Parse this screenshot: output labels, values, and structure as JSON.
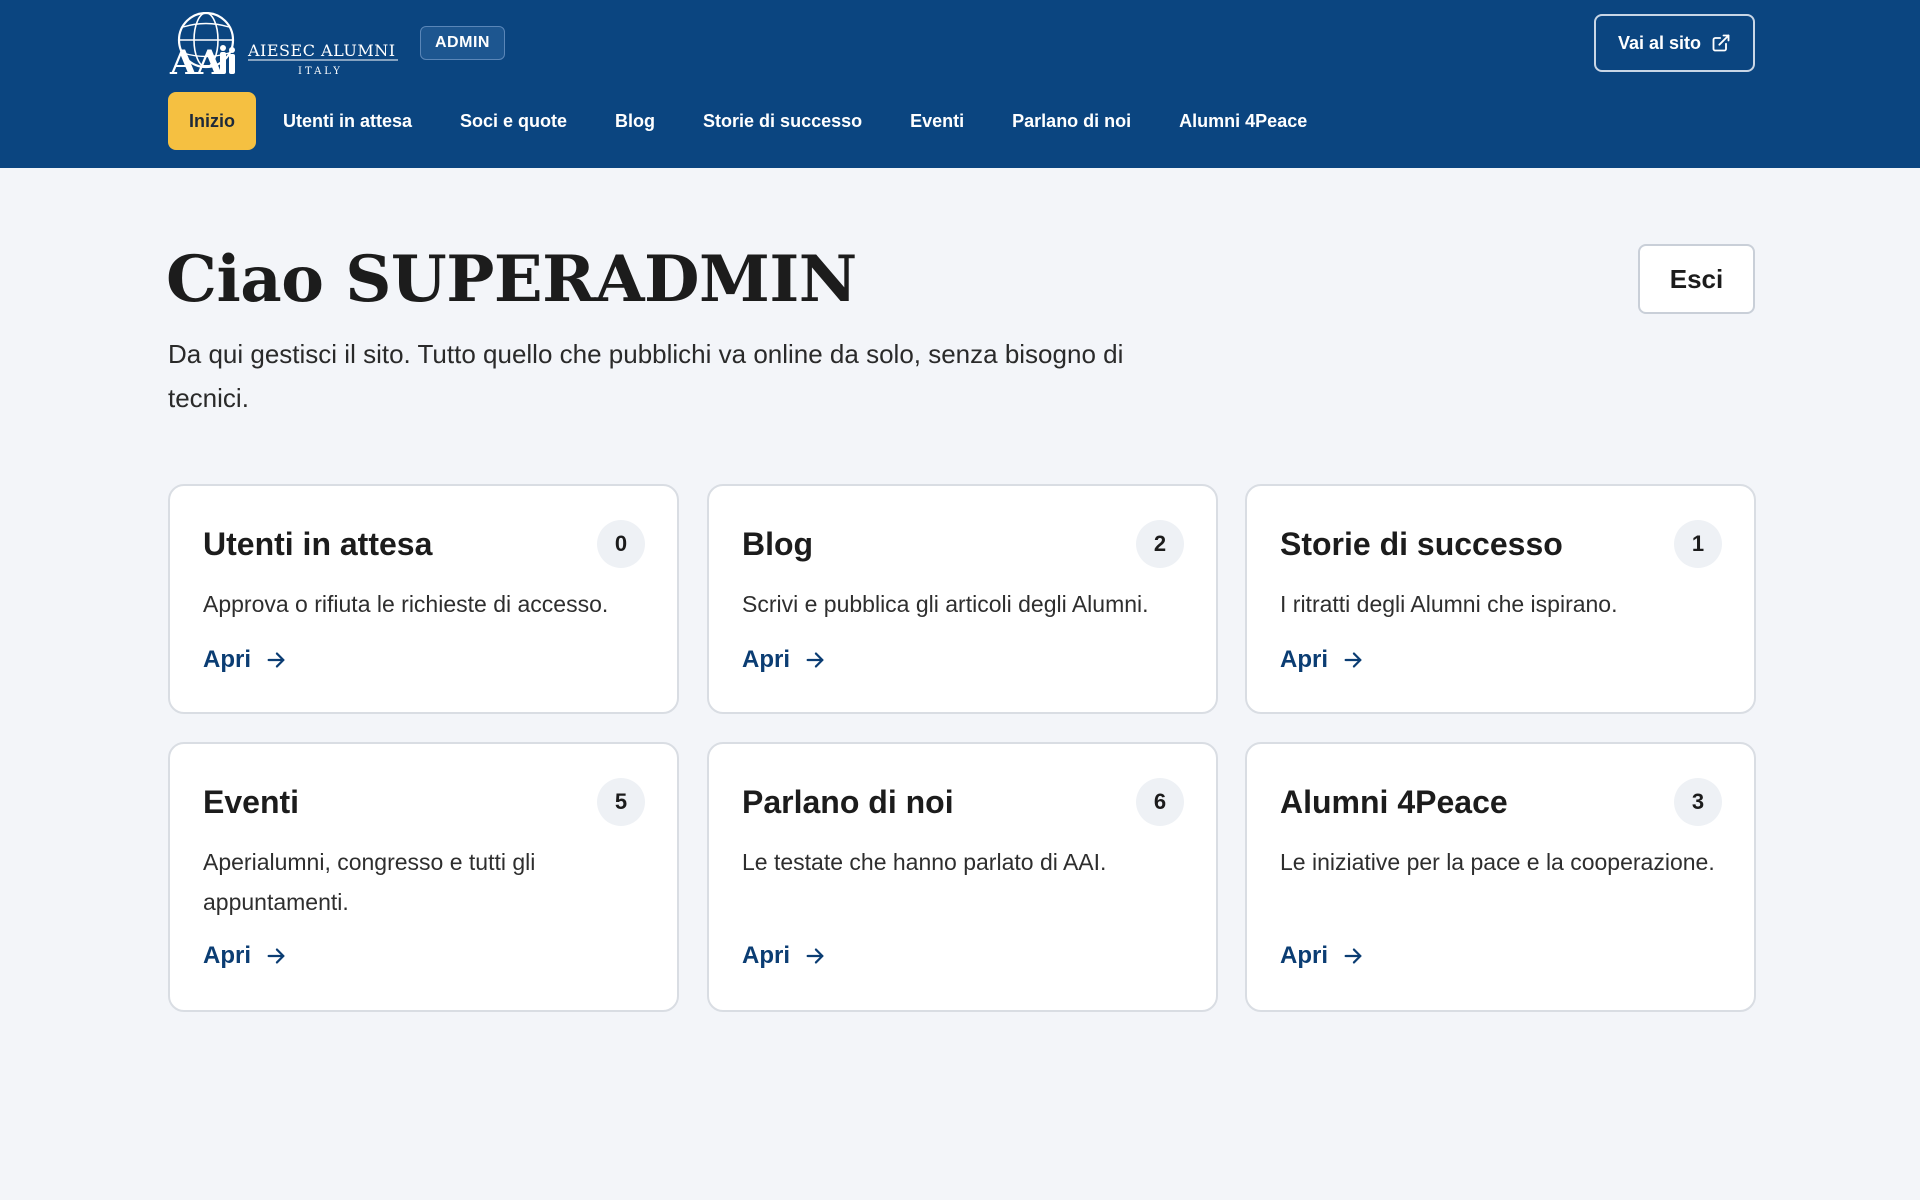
{
  "header": {
    "logo_alt": "AIESEC ALUMNI ITALY",
    "admin_badge": "ADMIN",
    "site_button": "Vai al sito"
  },
  "nav": {
    "items": [
      {
        "label": "Inizio",
        "active": true
      },
      {
        "label": "Utenti in attesa"
      },
      {
        "label": "Soci e quote"
      },
      {
        "label": "Blog"
      },
      {
        "label": "Storie di successo"
      },
      {
        "label": "Eventi"
      },
      {
        "label": "Parlano di noi"
      },
      {
        "label": "Alumni 4Peace"
      }
    ]
  },
  "main": {
    "title": "Ciao SUPERADMIN",
    "intro": "Da qui gestisci il sito. Tutto quello che pubblichi va online da solo, senza bisogno di tecnici.",
    "logout": "Esci"
  },
  "cards": [
    {
      "title": "Utenti in attesa",
      "count": "0",
      "desc": "Approva o rifiuta le richieste di accesso.",
      "link": "Apri"
    },
    {
      "title": "Blog",
      "count": "2",
      "desc": "Scrivi e pubblica gli articoli degli Alumni.",
      "link": "Apri"
    },
    {
      "title": "Storie di successo",
      "count": "1",
      "desc": "I ritratti degli Alumni che ispirano.",
      "link": "Apri"
    },
    {
      "title": "Eventi",
      "count": "5",
      "desc": "Aperialumni, congresso e tutti gli appuntamenti.",
      "link": "Apri"
    },
    {
      "title": "Parlano di noi",
      "count": "6",
      "desc": "Le testate che hanno parlato di AAI.",
      "link": "Apri"
    },
    {
      "title": "Alumni 4Peace",
      "count": "3",
      "desc": "Le iniziative per la pace e la cooperazione.",
      "link": "Apri"
    }
  ],
  "colors": {
    "header_bg": "#0b4580",
    "active_nav": "#f5c041",
    "page_bg": "#f3f5f9",
    "link": "#0b3d73"
  }
}
